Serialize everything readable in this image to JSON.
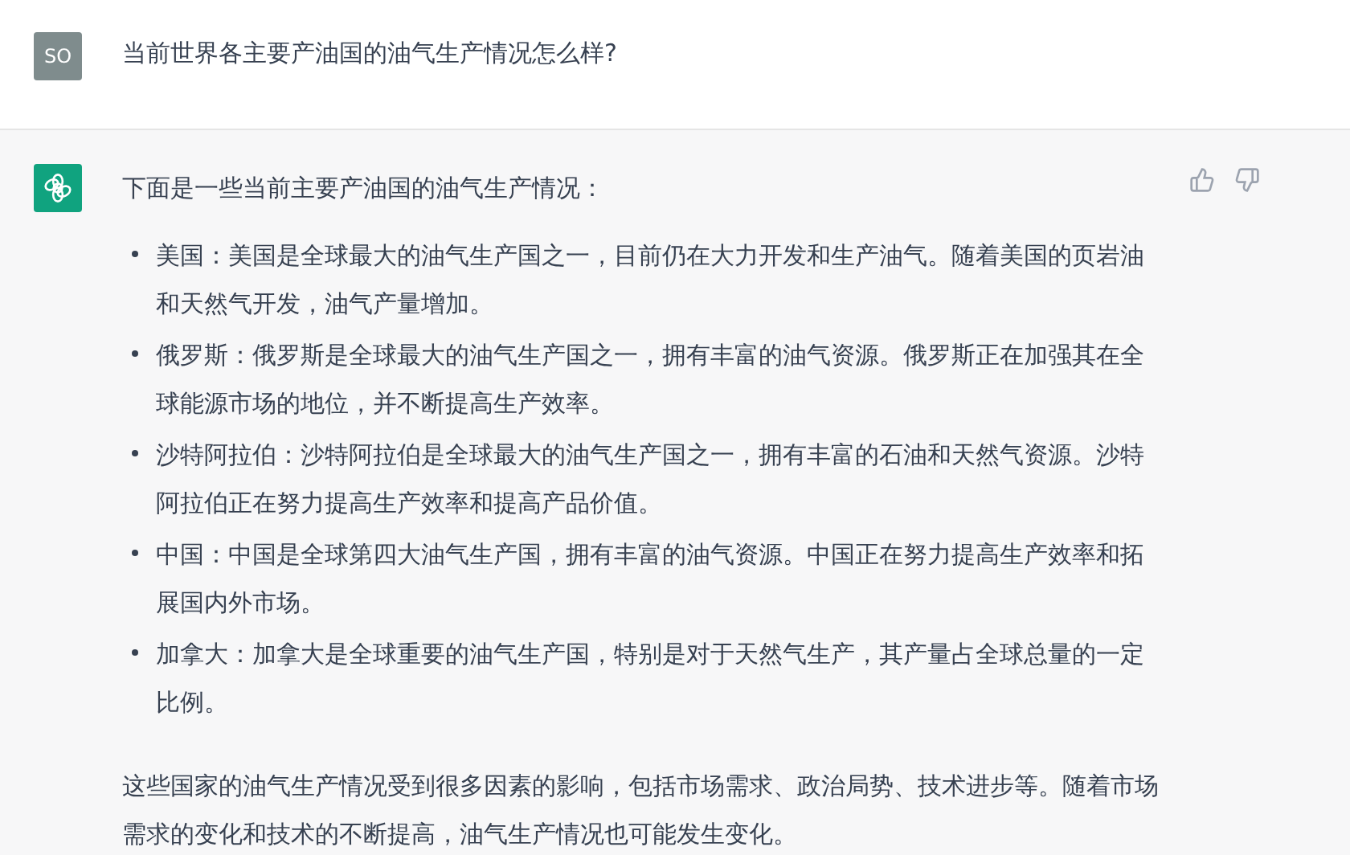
{
  "user_message": {
    "avatar": "SO",
    "text": "当前世界各主要产油国的油气生产情况怎么样?"
  },
  "assistant_message": {
    "intro": "下面是一些当前主要产油国的油气生产情况：",
    "bullets": [
      "美国：美国是全球最大的油气生产国之一，目前仍在大力开发和生产油气。随着美国的页岩油和天然气开发，油气产量增加。",
      "俄罗斯：俄罗斯是全球最大的油气生产国之一，拥有丰富的油气资源。俄罗斯正在加强其在全球能源市场的地位，并不断提高生产效率。",
      "沙特阿拉伯：沙特阿拉伯是全球最大的油气生产国之一，拥有丰富的石油和天然气资源。沙特阿拉伯正在努力提高生产效率和提高产品价值。",
      "中国：中国是全球第四大油气生产国，拥有丰富的油气资源。中国正在努力提高生产效率和拓展国内外市场。",
      "加拿大：加拿大是全球重要的油气生产国，特别是对于天然气生产，其产量占全球总量的一定比例。"
    ],
    "conclusion": "这些国家的油气生产情况受到很多因素的影响，包括市场需求、政治局势、技术进步等。随着市场需求的变化和技术的不断提高，油气生产情况也可能发生变化。"
  }
}
